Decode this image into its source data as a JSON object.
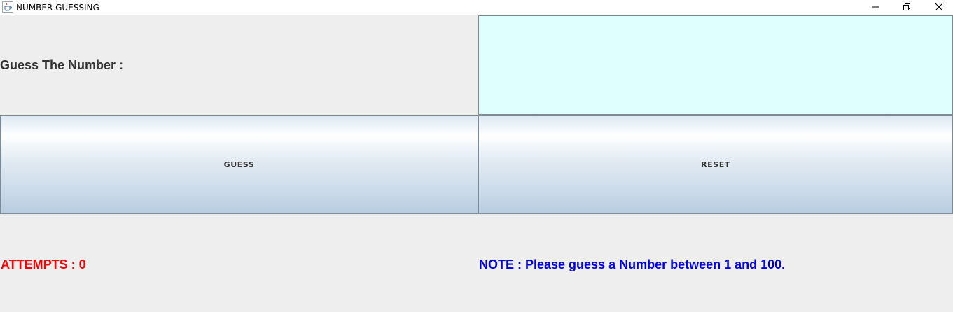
{
  "window": {
    "title": "NUMBER GUESSING",
    "app_icon": "java-cup-icon",
    "controls": [
      "minimize-icon",
      "restore-icon",
      "close-icon"
    ]
  },
  "form": {
    "prompt_label": "Guess The Number :",
    "input_value": "",
    "input_background": "#dfffff"
  },
  "buttons": {
    "guess_label": "GUESS",
    "reset_label": "RESET"
  },
  "status": {
    "attempts_label": "ATTEMPTS : 0",
    "attempts_color": "#ff0000",
    "note_label": "NOTE : Please guess a Number between 1 and 100.",
    "note_color": "#0000e6"
  }
}
